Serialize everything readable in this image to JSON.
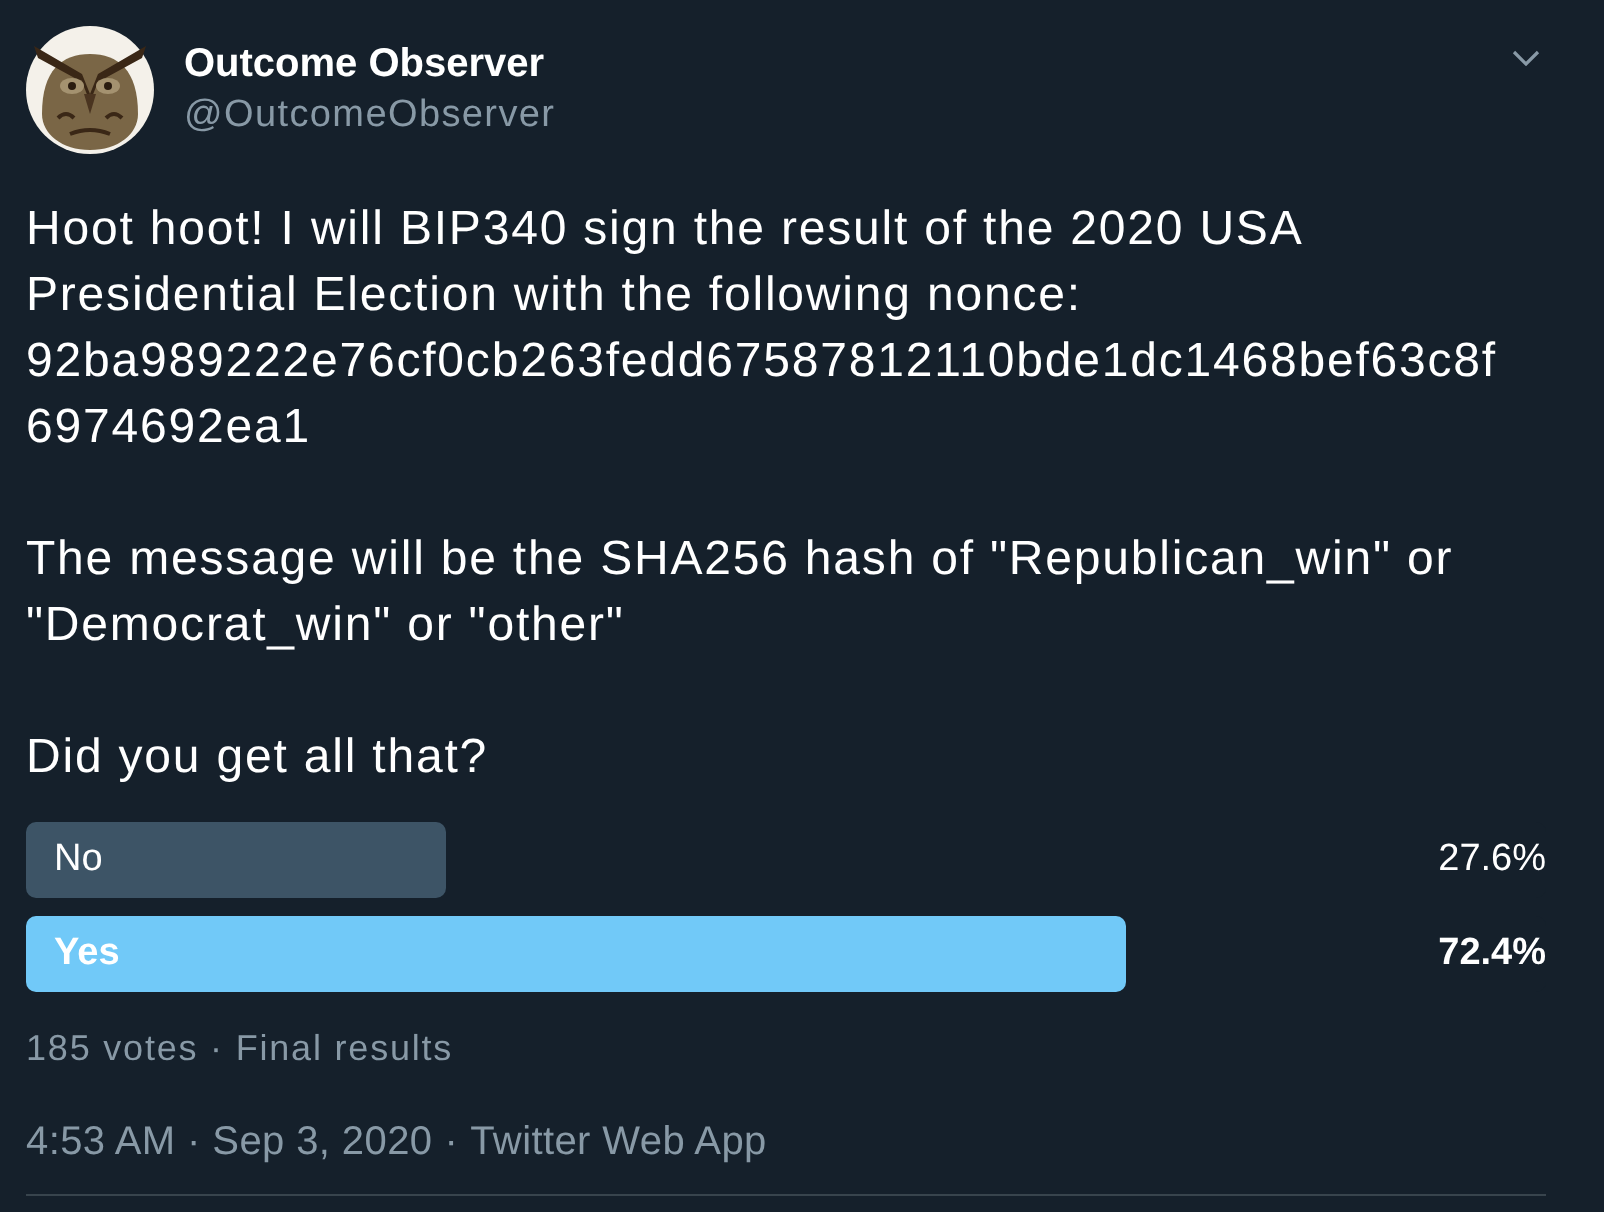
{
  "author": {
    "name": "Outcome Observer",
    "handle": "@OutcomeObserver"
  },
  "tweet": {
    "paragraphs": [
      "Hoot hoot! I will BIP340 sign the result of the 2020 USA Presidential Election with the following nonce: 92ba989222e76cf0cb263fedd67587812110bde1dc1468bef63c8f6974692ea1",
      "The message will be the SHA256 hash of \"Republican_win\" or \"Democrat_win\" or \"other\"",
      "Did you get all that?"
    ]
  },
  "poll": {
    "options": [
      {
        "label": "No",
        "percent": "27.6%",
        "level": 0.276,
        "winner": false
      },
      {
        "label": "Yes",
        "percent": "72.4%",
        "level": 0.724,
        "winner": true
      }
    ],
    "summary": "185 votes · Final results"
  },
  "meta": {
    "time": "4:53 AM · Sep 3, 2020",
    "separator": "·",
    "source": "Twitter Web App"
  }
}
